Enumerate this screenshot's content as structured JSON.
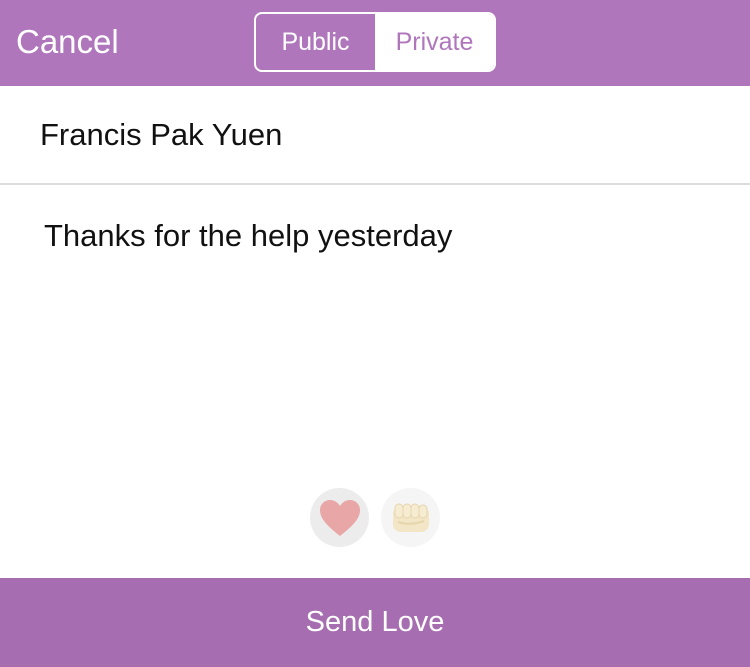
{
  "colors": {
    "accent": "#b076bc",
    "send_bar": "#a66eb1",
    "heart": "#e8a6a6",
    "fist": "#f3e6c6"
  },
  "navbar": {
    "cancel_label": "Cancel",
    "segments": [
      {
        "label": "Public",
        "selected": false
      },
      {
        "label": "Private",
        "selected": true
      }
    ]
  },
  "form": {
    "recipient": "Francis Pak Yuen",
    "message": "Thanks for the help yesterday"
  },
  "reactions": [
    {
      "icon": "heart-icon"
    },
    {
      "icon": "fist-icon"
    }
  ],
  "footer": {
    "send_label": "Send Love"
  }
}
